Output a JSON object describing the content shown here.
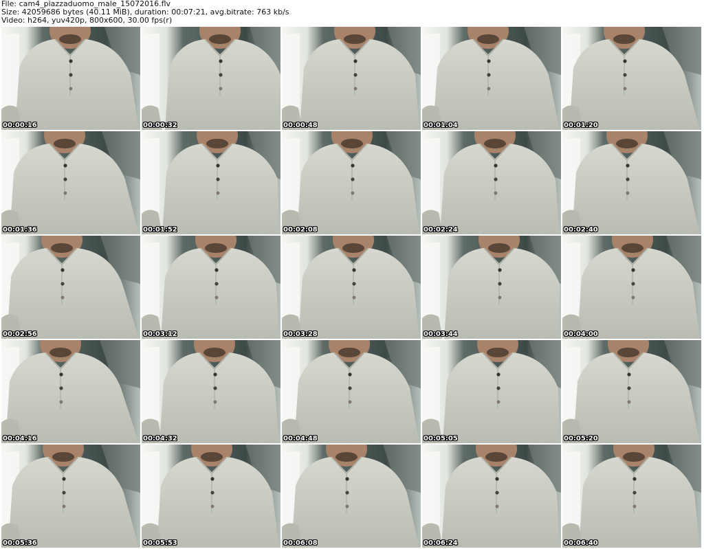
{
  "header": {
    "line1": "File: cam4_piazzaduomo_male_15072016.flv",
    "line2": "Size: 42059686 bytes (40.11 MiB), duration: 00:07:21, avg.bitrate: 763 kb/s",
    "line3": "Video: h264, yuv420p, 800x600, 30.00 fps(r)"
  },
  "frames": [
    "00:00:16",
    "00:00:32",
    "00:00:48",
    "00:01:04",
    "00:01:20",
    "00:01:36",
    "00:01:52",
    "00:02:08",
    "00:02:24",
    "00:02:40",
    "00:02:56",
    "00:03:12",
    "00:03:28",
    "00:03:44",
    "00:04:00",
    "00:04:16",
    "00:04:32",
    "00:04:48",
    "00:05:05",
    "00:05:20",
    "00:05:36",
    "00:05:53",
    "00:06:08",
    "00:06:24",
    "00:06:40"
  ],
  "grid": {
    "columns": 5,
    "rows": 5
  }
}
